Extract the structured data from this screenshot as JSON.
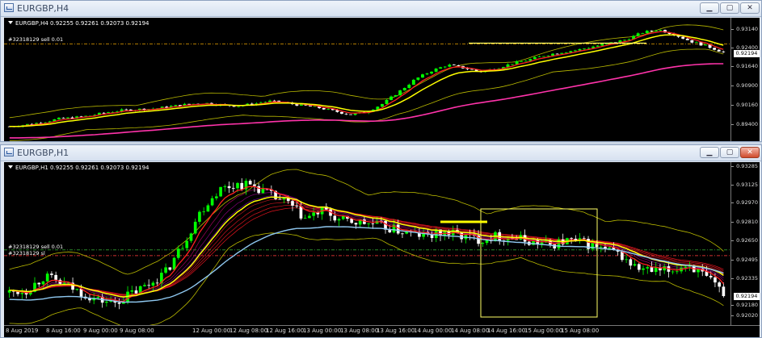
{
  "colors": {
    "up_candle": "#00ff00",
    "down_candle": "#ffffff",
    "ma_fast": "#ff2020",
    "ma_slow": "#ffff00",
    "ma_long": "#ff33aa",
    "bands": "#b8b800",
    "dotted_green": "#2a8a2a",
    "dotted_red": "#d03030"
  },
  "h4": {
    "title": "EURGBP,H4",
    "header": "EURGBP,H4  0.92255 0.92261 0.92073 0.92194",
    "order_label": "#32318129 sell 0.01",
    "price_labels": [
      "0.93140",
      "0.92400",
      "0.91640",
      "0.90900",
      "0.90160",
      "0.89400"
    ],
    "current_price": "0.92194",
    "series": [
      0.8928,
      0.8935,
      0.8944,
      0.8958,
      0.8963,
      0.8971,
      0.8984,
      0.8992,
      0.8996,
      0.8999,
      0.9008,
      0.9016,
      0.9021,
      0.9014,
      0.9009,
      0.9017,
      0.9028,
      0.9021,
      0.9012,
      0.9003,
      0.8989,
      0.8975,
      0.8985,
      0.9018,
      0.9065,
      0.9115,
      0.9148,
      0.9172,
      0.916,
      0.9145,
      0.9158,
      0.9178,
      0.9192,
      0.921,
      0.9222,
      0.9231,
      0.9245,
      0.9258,
      0.9272,
      0.93,
      0.9312,
      0.9292,
      0.9265,
      0.9246,
      0.9222
    ]
  },
  "h1": {
    "title": "EURGBP,H1",
    "header": "EURGBP,H1  0.92255 0.92261 0.92073 0.92194",
    "order_label": "#32318129 sell 0.01",
    "sl_label": "#32318129 sl",
    "price_labels": [
      "0.93285",
      "0.93125",
      "0.92970",
      "0.92810",
      "0.92650",
      "0.92495",
      "0.92335",
      "0.92180",
      "0.92020"
    ],
    "current_price": "0.92194",
    "time_labels": [
      "8 Aug 2019",
      "8 Aug 16:00",
      "9 Aug 00:00",
      "9 Aug 08:00",
      "12 Aug 00:00",
      "12 Aug 08:00",
      "12 Aug 16:00",
      "13 Aug 00:00",
      "13 Aug 08:00",
      "13 Aug 16:00",
      "14 Aug 00:00",
      "14 Aug 08:00",
      "14 Aug 16:00",
      "15 Aug 00:00",
      "15 Aug 08:00"
    ],
    "series": [
      0.9219,
      0.9221,
      0.9233,
      0.9227,
      0.922,
      0.9213,
      0.921,
      0.9218,
      0.9226,
      0.9237,
      0.9262,
      0.929,
      0.9308,
      0.9313,
      0.9312,
      0.9303,
      0.9296,
      0.9283,
      0.929,
      0.9281,
      0.928,
      0.9278,
      0.9274,
      0.927,
      0.9268,
      0.9271,
      0.9268,
      0.9265,
      0.9268,
      0.9266,
      0.9263,
      0.926,
      0.9264,
      0.9262,
      0.9257,
      0.9252,
      0.924,
      0.9237,
      0.9238,
      0.9244,
      0.9231,
      0.9219
    ]
  }
}
